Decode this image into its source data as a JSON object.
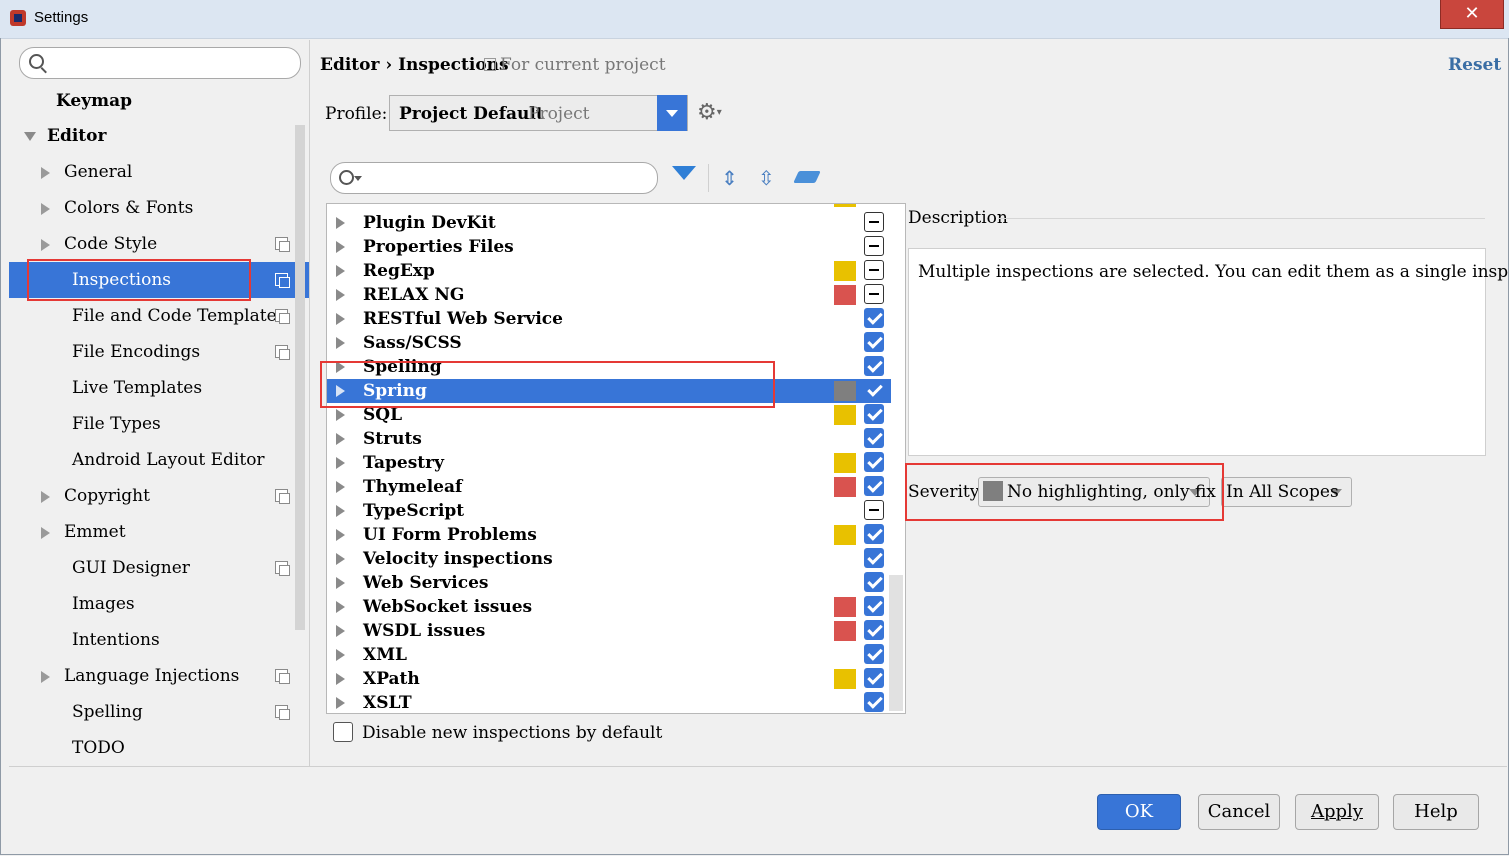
{
  "window": {
    "title": "Settings",
    "close_glyph": "✕"
  },
  "sidebar": {
    "search_placeholder": "",
    "items": [
      {
        "label": "Keymap"
      },
      {
        "label": "Editor"
      },
      {
        "label": "General"
      },
      {
        "label": "Colors & Fonts"
      },
      {
        "label": "Code Style"
      },
      {
        "label": "Inspections"
      },
      {
        "label": "File and Code Templates"
      },
      {
        "label": "File Encodings"
      },
      {
        "label": "Live Templates"
      },
      {
        "label": "File Types"
      },
      {
        "label": "Android Layout Editor"
      },
      {
        "label": "Copyright"
      },
      {
        "label": "Emmet"
      },
      {
        "label": "GUI Designer"
      },
      {
        "label": "Images"
      },
      {
        "label": "Intentions"
      },
      {
        "label": "Language Injections"
      },
      {
        "label": "Spelling"
      },
      {
        "label": "TODO"
      }
    ],
    "selected": "Inspections"
  },
  "header": {
    "breadcrumb": "Editor › Inspections",
    "scope_note": "For current project",
    "reset_label": "Reset"
  },
  "profile": {
    "label": "Profile:",
    "name": "Project Default",
    "type": "Project"
  },
  "toolbar": {
    "icons": [
      "filter-icon",
      "expand-all-icon",
      "collapse-all-icon",
      "eraser-icon"
    ]
  },
  "colors": {
    "accent": "#3875d7",
    "warning": "#e8c100",
    "error": "#d9534f",
    "none": "#7f7f7f",
    "highlight_box": "#e53935"
  },
  "inspections": [
    {
      "name": "Plugin DevKit",
      "severity": "",
      "state": "mixed"
    },
    {
      "name": "Properties Files",
      "severity": "",
      "state": "mixed"
    },
    {
      "name": "RegExp",
      "severity": "warning",
      "state": "mixed"
    },
    {
      "name": "RELAX NG",
      "severity": "error",
      "state": "mixed"
    },
    {
      "name": "RESTful Web Service",
      "severity": "",
      "state": "checked"
    },
    {
      "name": "Sass/SCSS",
      "severity": "",
      "state": "checked"
    },
    {
      "name": "Spelling",
      "severity": "",
      "state": "checked"
    },
    {
      "name": "Spring",
      "severity": "none",
      "state": "checked",
      "selected": true
    },
    {
      "name": "SQL",
      "severity": "warning",
      "state": "checked"
    },
    {
      "name": "Struts",
      "severity": "",
      "state": "checked"
    },
    {
      "name": "Tapestry",
      "severity": "warning",
      "state": "checked"
    },
    {
      "name": "Thymeleaf",
      "severity": "error",
      "state": "checked"
    },
    {
      "name": "TypeScript",
      "severity": "",
      "state": "mixed"
    },
    {
      "name": "UI Form Problems",
      "severity": "warning",
      "state": "checked"
    },
    {
      "name": "Velocity inspections",
      "severity": "",
      "state": "checked"
    },
    {
      "name": "Web Services",
      "severity": "",
      "state": "checked"
    },
    {
      "name": "WebSocket issues",
      "severity": "error",
      "state": "checked"
    },
    {
      "name": "WSDL issues",
      "severity": "error",
      "state": "checked"
    },
    {
      "name": "XML",
      "severity": "",
      "state": "checked"
    },
    {
      "name": "XPath",
      "severity": "warning",
      "state": "checked"
    },
    {
      "name": "XSLT",
      "severity": "",
      "state": "checked"
    }
  ],
  "disable_new": {
    "label": "Disable new inspections by default",
    "checked": false
  },
  "description": {
    "title": "Description",
    "text": "Multiple inspections are selected. You can edit them as a single inspection."
  },
  "severity": {
    "label": "Severity:",
    "value": "No highlighting, only fix"
  },
  "scope": {
    "value": "In All Scopes"
  },
  "buttons": {
    "ok": "OK",
    "cancel": "Cancel",
    "apply": "Apply",
    "help": "Help"
  }
}
